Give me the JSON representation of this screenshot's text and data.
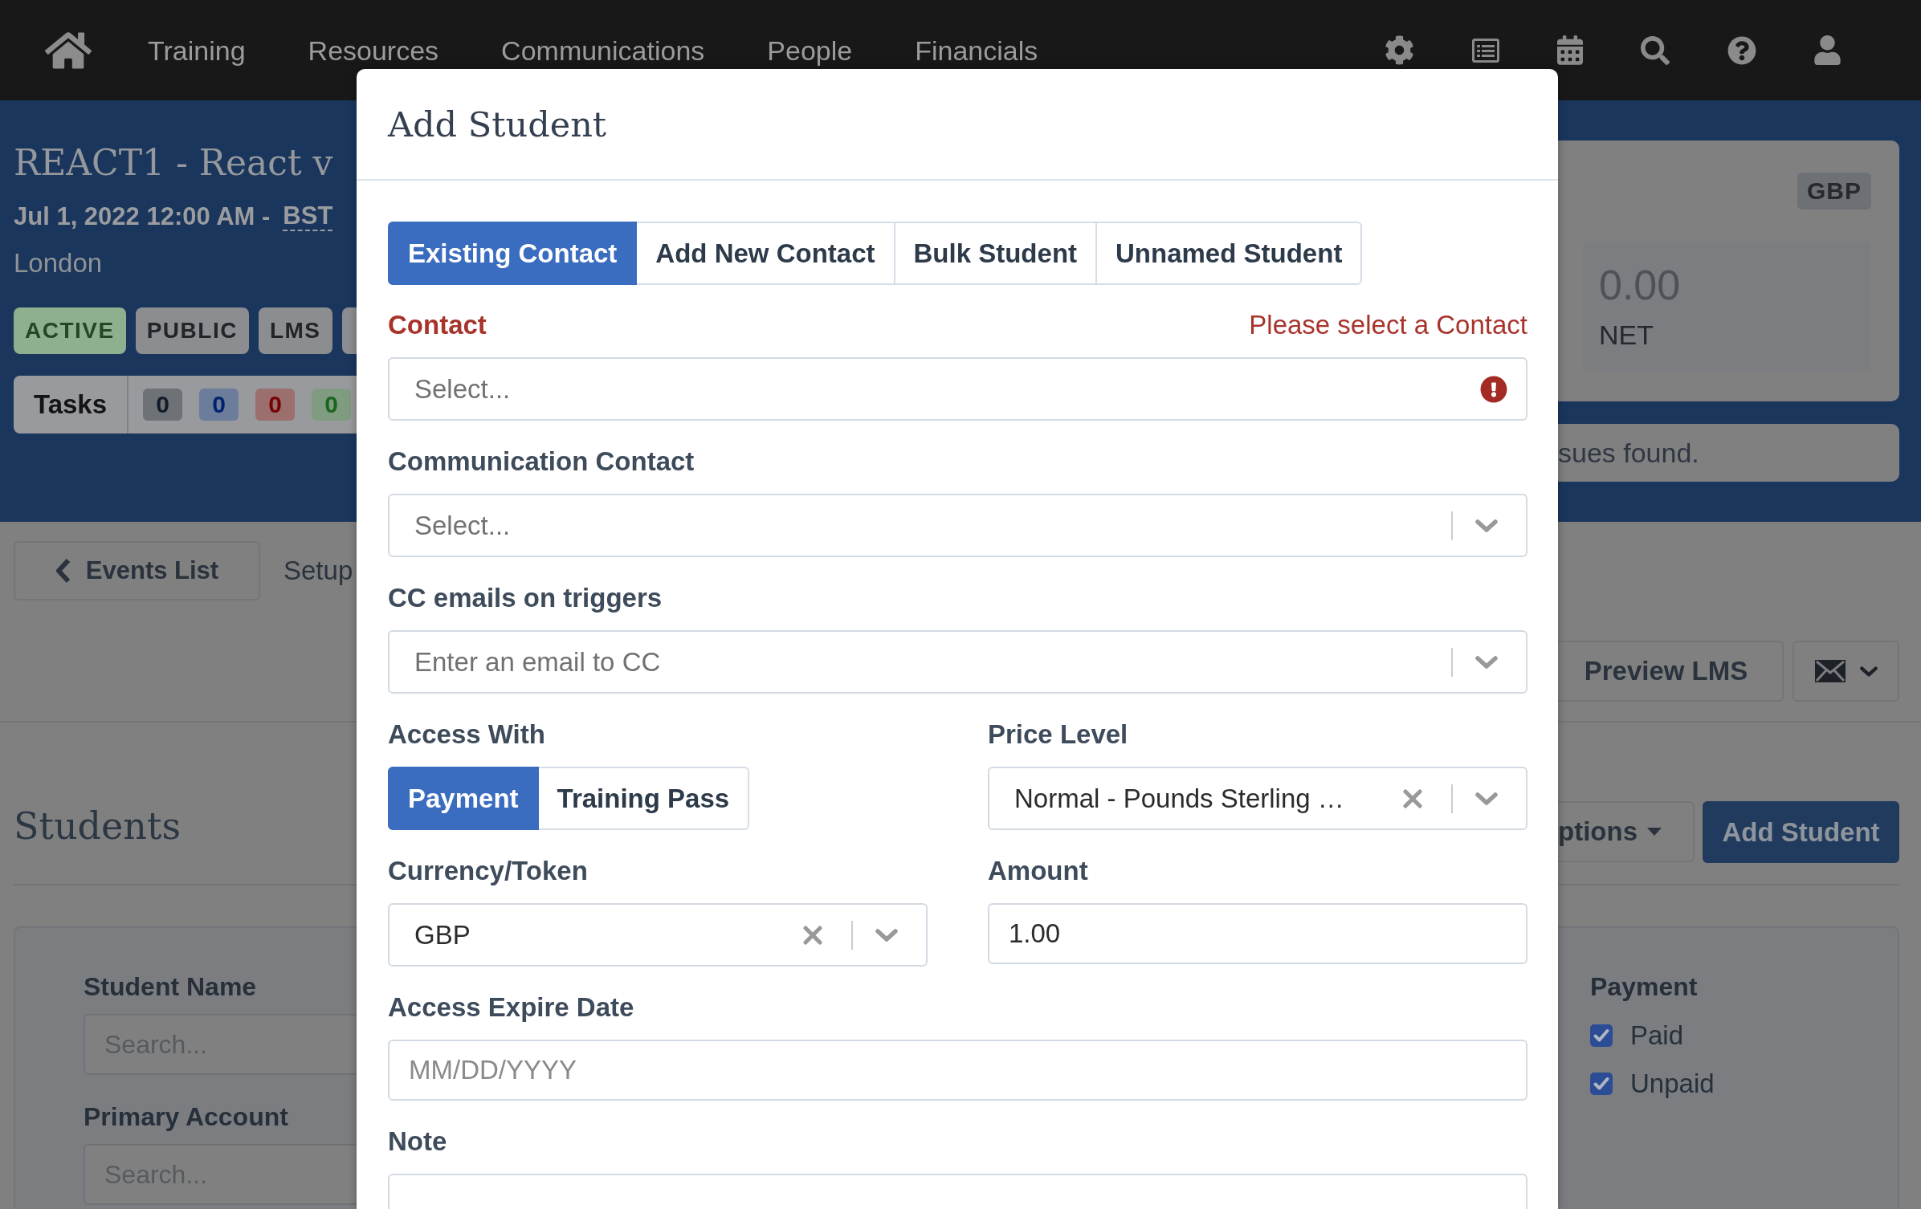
{
  "navbar": {
    "items": [
      "Training",
      "Resources",
      "Communications",
      "People",
      "Financials"
    ]
  },
  "event_header": {
    "title": "REACT1 - React v",
    "date_range": "Jul 1, 2022 12:00 AM -",
    "timezone": "BST",
    "location": "London",
    "tags": [
      {
        "label": "ACTIVE",
        "color": "#8fb08e"
      },
      {
        "label": "PUBLIC",
        "color": "#8b8d91"
      },
      {
        "label": "LMS",
        "color": "#8b8d91"
      },
      {
        "color": "#8b8d91"
      }
    ],
    "tasks": {
      "label": "Tasks",
      "counts": [
        {
          "value": "0",
          "color": "#6e7277"
        },
        {
          "value": "0",
          "color": "#6b7d9a"
        },
        {
          "value": "0",
          "color": "#9c6f6f"
        },
        {
          "value": "0",
          "color": "#7f9c80"
        }
      ]
    },
    "summary": {
      "currency": "GBP",
      "net_amount": "0.00",
      "net_label": "NET"
    },
    "issues": "sues found."
  },
  "toolbar": {
    "back_button": "Events List",
    "tab_label": "Setup",
    "preview_button": "Preview LMS"
  },
  "students": {
    "heading": "Students",
    "options_button": "ptions",
    "add_button": "Add Student",
    "filters": [
      {
        "label": "Student Name",
        "placeholder": "Search..."
      },
      {
        "label": "Primary Account",
        "placeholder": "Search..."
      }
    ],
    "payment": {
      "label": "Payment",
      "options": [
        {
          "label": "Paid",
          "checked": true
        },
        {
          "label": "Unpaid",
          "checked": true
        }
      ]
    }
  },
  "modal": {
    "title": "Add Student",
    "tabs": [
      {
        "label": "Existing Contact",
        "selected": true
      },
      {
        "label": "Add New Contact",
        "selected": false
      },
      {
        "label": "Bulk Student",
        "selected": false
      },
      {
        "label": "Unnamed Student",
        "selected": false
      }
    ],
    "rows": [
      {
        "fields": [
          {
            "kind": "select",
            "label": "Contact",
            "placeholder": "Select...",
            "invalid": true,
            "error": "Please select a Contact"
          }
        ]
      },
      {
        "fields": [
          {
            "kind": "select",
            "label": "Communication Contact",
            "placeholder": "Select...",
            "invalid": false
          }
        ]
      },
      {
        "fields": [
          {
            "kind": "select",
            "label": "CC emails on triggers",
            "placeholder": "Enter an email to CC",
            "invalid": false
          }
        ]
      },
      {
        "fields": [
          {
            "kind": "toggle",
            "label": "Access With",
            "invalid": false,
            "options": [
              {
                "label": "Payment",
                "selected": true
              },
              {
                "label": "Training Pass",
                "selected": false
              }
            ]
          },
          {
            "kind": "select",
            "label": "Price Level",
            "value": "Normal - Pounds Sterling …",
            "invalid": false
          }
        ]
      },
      {
        "fields": [
          {
            "kind": "select",
            "label": "Currency/Token",
            "value": "GBP",
            "invalid": false
          },
          {
            "kind": "text",
            "label": "Amount",
            "value": "1.00",
            "invalid": false
          }
        ]
      },
      {
        "fields": [
          {
            "kind": "text",
            "label": "Access Expire Date",
            "placeholder": "MM/DD/YYYY",
            "invalid": false
          }
        ]
      },
      {
        "fields": [
          {
            "kind": "textarea",
            "label": "Note",
            "invalid": false
          }
        ]
      }
    ]
  }
}
